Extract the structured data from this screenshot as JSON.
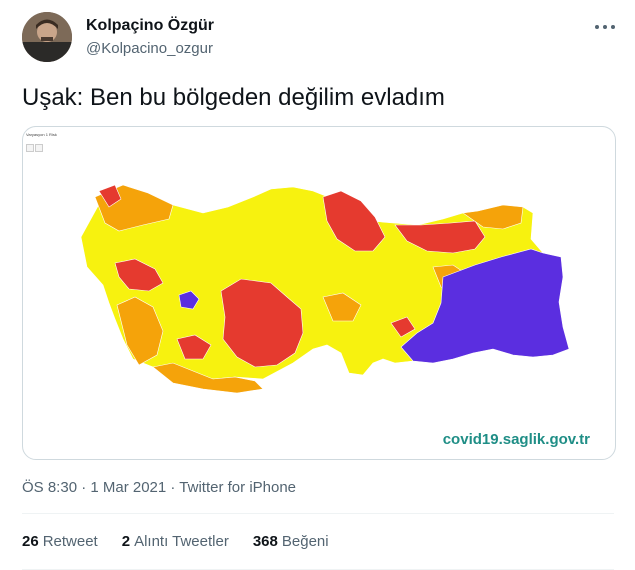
{
  "tweet": {
    "author_name": "Kolpaçino Özgür",
    "author_handle": "@Kolpacino_ozgur",
    "text": "Uşak: Ben bu bölgeden değilim evladım",
    "timestamp": "ÖS 8:30 · 1 Mar 2021 · Twitter for iPhone"
  },
  "media": {
    "map_header": "Varyasyon 1 Risk",
    "watermark": "covid19.saglik.gov.tr",
    "colors": {
      "very_high": "#e53a2f",
      "high": "#f5a30a",
      "medium": "#f7f20f",
      "low": "#5b2ee0",
      "outline": "#ffffff"
    }
  },
  "stats": {
    "retweets_count": "26",
    "retweets_label": "Retweet",
    "quotes_count": "2",
    "quotes_label": "Alıntı Tweetler",
    "likes_count": "368",
    "likes_label": "Beğeni"
  },
  "icons": {
    "more": "more-dots-icon"
  }
}
